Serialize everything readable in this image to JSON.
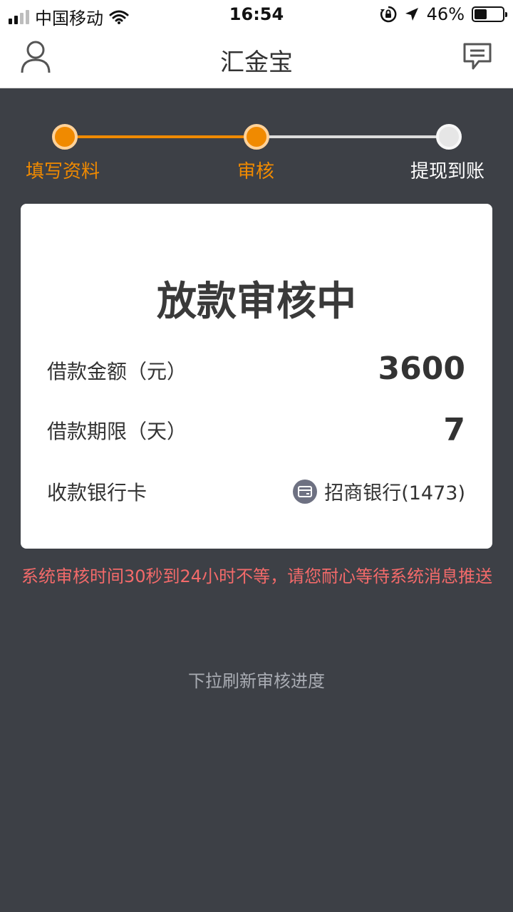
{
  "status_bar": {
    "carrier": "中国移动",
    "time": "16:54",
    "battery_percent": "46%",
    "battery_level": 0.46,
    "icons": [
      "signal-icon",
      "wifi-icon",
      "rotation-lock-icon",
      "location-icon",
      "battery-icon"
    ]
  },
  "nav": {
    "title": "汇金宝",
    "left_icon": "user-icon",
    "right_icon": "message-icon"
  },
  "steps": [
    {
      "label": "填写资料",
      "state": "done"
    },
    {
      "label": "审核",
      "state": "current"
    },
    {
      "label": "提现到账",
      "state": "pending"
    }
  ],
  "card": {
    "title": "放款审核中",
    "amount_label": "借款金额（元）",
    "amount_value": "3600",
    "term_label": "借款期限（天）",
    "term_value": "7",
    "bank_label": "收款银行卡",
    "bank_value": "招商银行(1473)",
    "bank_icon": "bank-card-icon"
  },
  "notice": "系统审核时间30秒到24小时不等，请您耐心等待系统消息推送",
  "pull_hint": "下拉刷新审核进度",
  "colors": {
    "accent": "#f08a00",
    "background": "#3d4046",
    "notice": "#f36a6a",
    "hint": "#a9acb3"
  }
}
